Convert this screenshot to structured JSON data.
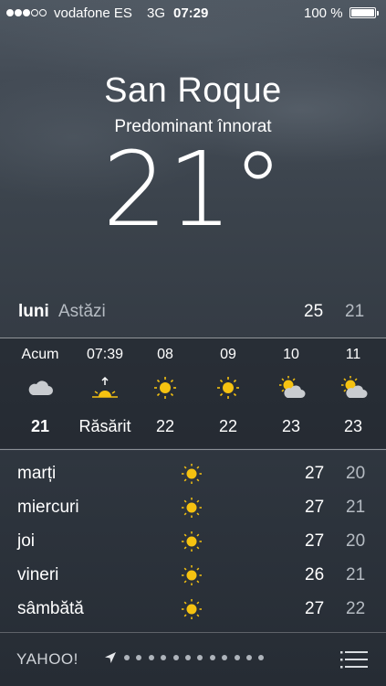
{
  "status_bar": {
    "signal_dots_filled": 3,
    "signal_dots_total": 5,
    "carrier": "vodafone ES",
    "network": "3G",
    "time": "07:29",
    "battery_percent": "100 %",
    "battery_level": 1.0
  },
  "location": {
    "city": "San Roque",
    "condition": "Predominant înnorat",
    "temperature": "21°"
  },
  "today": {
    "day": "luni",
    "label": "Astăzi",
    "high": "25",
    "low": "21"
  },
  "hourly": [
    {
      "time": "Acum",
      "icon": "cloud-icon",
      "value": "21"
    },
    {
      "time": "07:39",
      "icon": "sunrise-icon",
      "value": "Răsărit"
    },
    {
      "time": "08",
      "icon": "sun-icon",
      "value": "22"
    },
    {
      "time": "09",
      "icon": "sun-icon",
      "value": "22"
    },
    {
      "time": "10",
      "icon": "partly-cloudy-icon",
      "value": "23"
    },
    {
      "time": "11",
      "icon": "partly-cloudy-icon",
      "value": "23"
    }
  ],
  "daily": [
    {
      "day": "marți",
      "icon": "sun-icon",
      "high": "27",
      "low": "20"
    },
    {
      "day": "miercuri",
      "icon": "sun-icon",
      "high": "27",
      "low": "21"
    },
    {
      "day": "joi",
      "icon": "sun-icon",
      "high": "27",
      "low": "20"
    },
    {
      "day": "vineri",
      "icon": "sun-icon",
      "high": "26",
      "low": "21"
    },
    {
      "day": "sâmbătă",
      "icon": "sun-icon",
      "high": "27",
      "low": "22"
    }
  ],
  "footer": {
    "provider": "YAHOO!",
    "page_count": 12,
    "icons": [
      "location-arrow-icon",
      "list-menu-icon"
    ]
  },
  "colors": {
    "sun": "#f5c211",
    "cloud": "#c9ccd0",
    "secondary_text": "#b6bcc3"
  }
}
